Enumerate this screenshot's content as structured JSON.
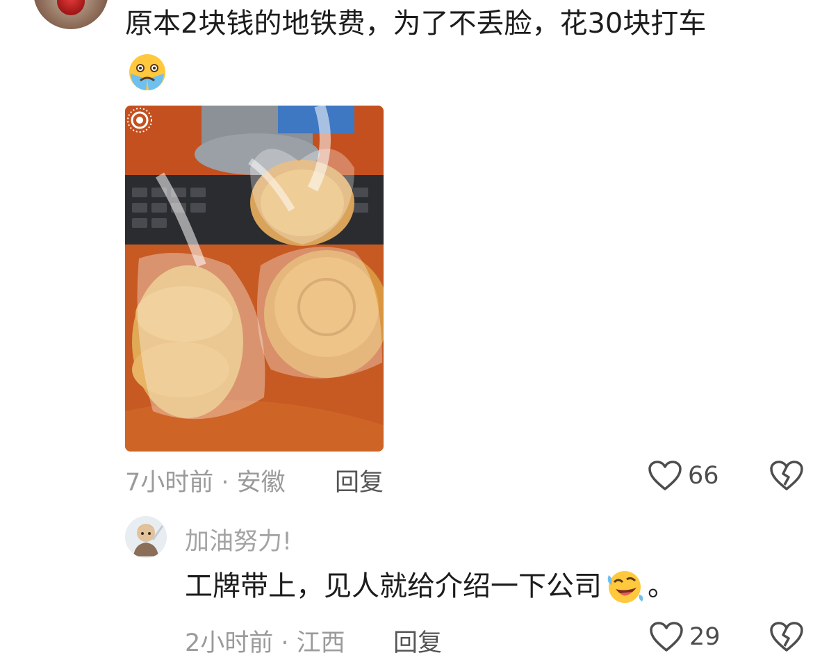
{
  "comment": {
    "text": "原本2块钱的地铁费，为了不丢脸，花30块打车",
    "emoji": "crying-face-emoji",
    "meta": "7小时前 · 安徽",
    "reply_label": "回复",
    "like_count": "66"
  },
  "reply": {
    "username": "加油努力!",
    "text": "工牌带上，见人就给介绍一下公司",
    "emoji": "rolling-laughing-emoji",
    "suffix": "。",
    "meta": "2小时前 · 江西",
    "reply_label": "回复",
    "like_count": "29"
  },
  "colors": {
    "meta_gray": "#9a9a9a",
    "text_dark": "#1c1c1c",
    "icon_gray": "#4d4d4d"
  }
}
